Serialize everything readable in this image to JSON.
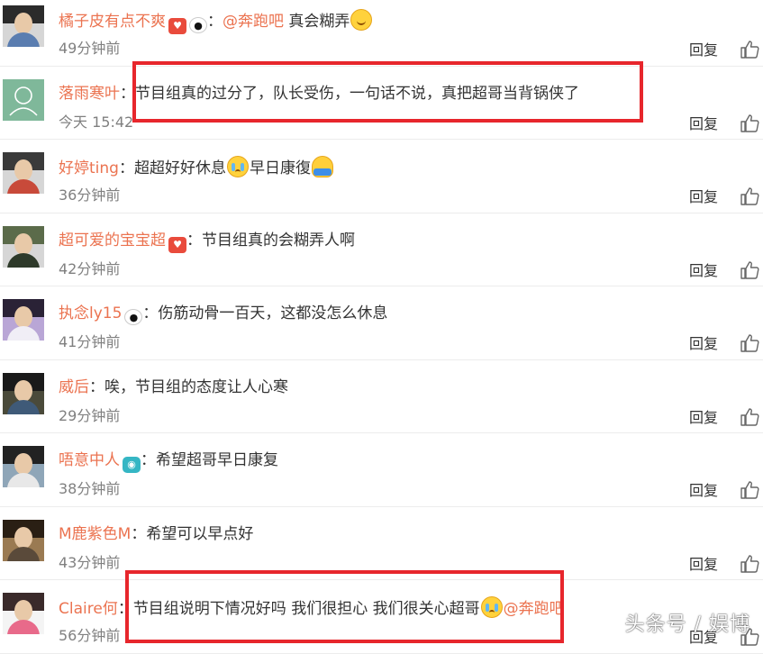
{
  "colors": {
    "username": "#eb7350",
    "text": "#333333",
    "time": "#808080",
    "highlight": "#e7262c",
    "divider": "#ececec"
  },
  "comments": [
    {
      "user": "橘子皮有点不爽",
      "badges": [
        "heart-badge-icon",
        "panda-badge-icon"
      ],
      "sep": "：",
      "mention": "@奔跑吧",
      "text": " 真会糊弄",
      "emoji": "smile-emoji-icon",
      "time": "49分钟前",
      "reply": "回复"
    },
    {
      "user": "落雨寒叶",
      "sep": "：",
      "text": "节目组真的过分了，队长受伤，一句话不说，真把超哥当背锅侠了",
      "time": "今天 15:42",
      "reply": "回复"
    },
    {
      "user": "好婷ting",
      "sep": "：",
      "text": "超超好好休息",
      "emoji": "crying-emoji-icon",
      "text2": "早日康復",
      "emoji2": "hug-emoji-icon",
      "time": "36分钟前",
      "reply": "回复"
    },
    {
      "user": "超可爱的宝宝超",
      "badges": [
        "heart-badge-icon"
      ],
      "sep": "：",
      "text": "节目组真的会糊弄人啊",
      "time": "42分钟前",
      "reply": "回复"
    },
    {
      "user": "执念ly15",
      "badges": [
        "panda-badge-icon"
      ],
      "sep": "：",
      "text": "伤筋动骨一百天，这都没怎么休息",
      "time": "41分钟前",
      "reply": "回复"
    },
    {
      "user": "威后",
      "sep": "：",
      "text": "唉，节目组的态度让人心寒",
      "time": "29分钟前",
      "reply": "回复"
    },
    {
      "user": "唔意中人",
      "badges": [
        "camera-badge-icon"
      ],
      "sep": "：",
      "text": "希望超哥早日康复",
      "time": "38分钟前",
      "reply": "回复"
    },
    {
      "user": "M鹿紫色M",
      "sep": "：",
      "text": "希望可以早点好",
      "time": "43分钟前",
      "reply": "回复"
    },
    {
      "user": "Claire何",
      "sep": "：",
      "text": "节目组说明下情况好吗 我们很担心 我们很关心超哥",
      "emoji": "crying-emoji-icon",
      "mention": "@奔跑吧",
      "time": "56分钟前",
      "reply": "回复"
    }
  ],
  "watermark": "头条号 / 娱博"
}
